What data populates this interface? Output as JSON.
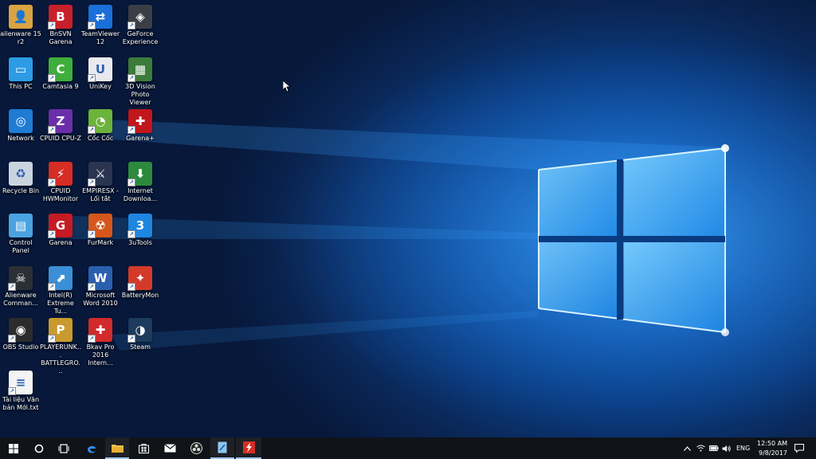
{
  "desktop": {
    "icons": [
      {
        "label": "alienware 15 r2",
        "icon": "folder-user-icon",
        "bg": "#d9a441",
        "glyph": "👤"
      },
      {
        "label": "BnSVN Garena",
        "icon": "bnsvn-icon",
        "bg": "#c8202a",
        "glyph": "B"
      },
      {
        "label": "TeamViewer 12",
        "icon": "teamviewer-icon",
        "bg": "#1a6fd8",
        "glyph": "⇄"
      },
      {
        "label": "GeForce Experience",
        "icon": "geforce-icon",
        "bg": "#3b3f45",
        "glyph": "◈"
      },
      {
        "label": "This PC",
        "icon": "computer-icon",
        "bg": "#2d9be6",
        "glyph": "▭"
      },
      {
        "label": "Camtasia 9",
        "icon": "camtasia-icon",
        "bg": "#3fae3c",
        "glyph": "C"
      },
      {
        "label": "UniKey",
        "icon": "unikey-icon",
        "bg": "#e9e9ee",
        "glyph": "U"
      },
      {
        "label": "3D Vision Photo Viewer",
        "icon": "3d-vision-icon",
        "bg": "#3b7c3a",
        "glyph": "▦"
      },
      {
        "label": "Network",
        "icon": "network-icon",
        "bg": "#1f7bd4",
        "glyph": "◎"
      },
      {
        "label": "CPUID CPU-Z",
        "icon": "cpuz-icon",
        "bg": "#6a2fa8",
        "glyph": "Z"
      },
      {
        "label": "Cốc Cốc",
        "icon": "coccoc-icon",
        "bg": "#6bb33a",
        "glyph": "◔"
      },
      {
        "label": "Garena+",
        "icon": "garena-plus-icon",
        "bg": "#c0161c",
        "glyph": "✚"
      },
      {
        "label": "Recycle Bin",
        "icon": "recycle-bin-icon",
        "bg": "#c9d4de",
        "glyph": "♻"
      },
      {
        "label": "CPUID HWMonitor",
        "icon": "hwmonitor-icon",
        "bg": "#d62d24",
        "glyph": "⚡"
      },
      {
        "label": "EMPIRESX - Lối tắt",
        "icon": "empires-icon",
        "bg": "#2a3550",
        "glyph": "⚔"
      },
      {
        "label": "Internet Downloa...",
        "icon": "idm-icon",
        "bg": "#2d8a3c",
        "glyph": "⬇"
      },
      {
        "label": "Control Panel",
        "icon": "control-panel-icon",
        "bg": "#4aa3e0",
        "glyph": "▤"
      },
      {
        "label": "Garena",
        "icon": "garena-icon",
        "bg": "#c51b22",
        "glyph": "G"
      },
      {
        "label": "FurMark",
        "icon": "furmark-icon",
        "bg": "#d5571b",
        "glyph": "☢"
      },
      {
        "label": "3uTools",
        "icon": "3utools-icon",
        "bg": "#1f86e0",
        "glyph": "3"
      },
      {
        "label": "Alienware Comman...",
        "icon": "alienware-icon",
        "bg": "#2b2f36",
        "glyph": "☠"
      },
      {
        "label": "Intel(R) Extreme Tu...",
        "icon": "intel-xtu-icon",
        "bg": "#3b8fd6",
        "glyph": "⬈"
      },
      {
        "label": "Microsoft Word 2010",
        "icon": "word-icon",
        "bg": "#2a5fae",
        "glyph": "W"
      },
      {
        "label": "BatteryMon",
        "icon": "batterymon-icon",
        "bg": "#d43a2a",
        "glyph": "✦"
      },
      {
        "label": "OBS Studio",
        "icon": "obs-icon",
        "bg": "#2c2c2c",
        "glyph": "◉"
      },
      {
        "label": "PLAYERUNK... BATTLEGRO...",
        "icon": "pubg-icon",
        "bg": "#c99a2e",
        "glyph": "P"
      },
      {
        "label": "Bkav Pro 2016 Intern...",
        "icon": "bkav-icon",
        "bg": "#d22b2b",
        "glyph": "✚"
      },
      {
        "label": "Steam",
        "icon": "steam-icon",
        "bg": "#1d3b5c",
        "glyph": "◑"
      },
      {
        "label": "Tài liệu Văn bản Mới.txt",
        "icon": "text-file-icon",
        "bg": "#f4f4f4",
        "glyph": "≡"
      }
    ]
  },
  "taskbar": {
    "items": [
      {
        "name": "start-button",
        "icon": "windows-logo-icon"
      },
      {
        "name": "cortana-button",
        "icon": "cortana-circle-icon"
      },
      {
        "name": "task-view-button",
        "icon": "task-view-icon"
      },
      {
        "name": "edge-button",
        "icon": "edge-icon"
      },
      {
        "name": "file-explorer-button",
        "icon": "folder-icon"
      },
      {
        "name": "store-button",
        "icon": "store-icon"
      },
      {
        "name": "mail-button",
        "icon": "mail-icon"
      },
      {
        "name": "obs-taskbar-button",
        "icon": "obs-icon"
      },
      {
        "name": "xtu-taskbar-button",
        "icon": "intel-xtu-icon"
      },
      {
        "name": "hwmonitor-taskbar-button",
        "icon": "hwmonitor-icon"
      }
    ],
    "tray": {
      "language": "ENG",
      "time": "12:50 AM",
      "date": "9/8/2017"
    }
  },
  "colors": {
    "taskbar_bg": "#101318",
    "accent": "#1a8fff"
  }
}
